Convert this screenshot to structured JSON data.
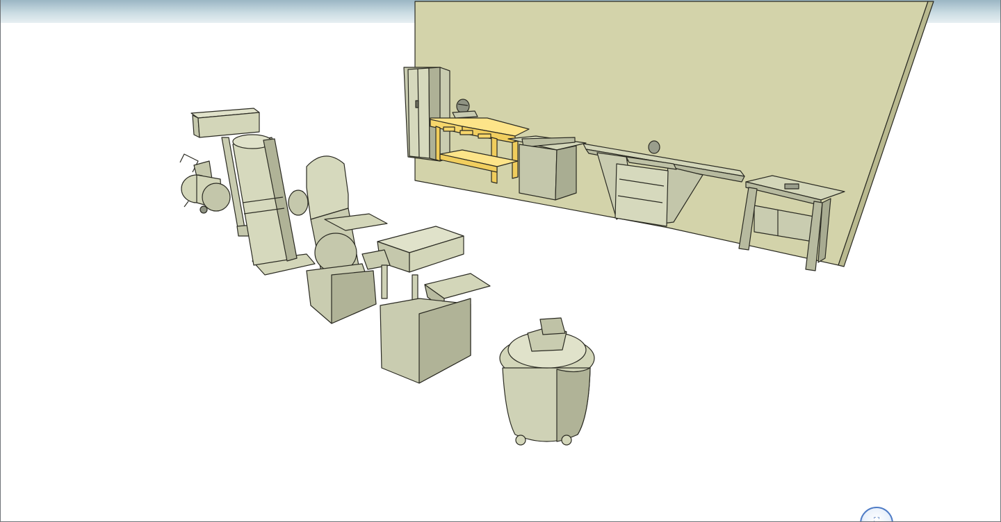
{
  "viewport": {
    "sky_color": "#b6ccd7",
    "wall_color": "#d3d3aa",
    "equipment_color": "#d3d6b9",
    "bench_color": "#fde489"
  },
  "models": [
    {
      "name": "air-compressor"
    },
    {
      "name": "drill-press"
    },
    {
      "name": "dust-collector"
    },
    {
      "name": "band-saw"
    },
    {
      "name": "storage-cabinet"
    },
    {
      "name": "miter-saw"
    },
    {
      "name": "workbench"
    },
    {
      "name": "table-saw"
    },
    {
      "name": "miter-saw-station"
    },
    {
      "name": "router-table"
    },
    {
      "name": "thickness-planer"
    },
    {
      "name": "shop-vacuum"
    }
  ],
  "nav_widget": {
    "icon": "orbit-navigation-icon",
    "label": "⛶"
  }
}
